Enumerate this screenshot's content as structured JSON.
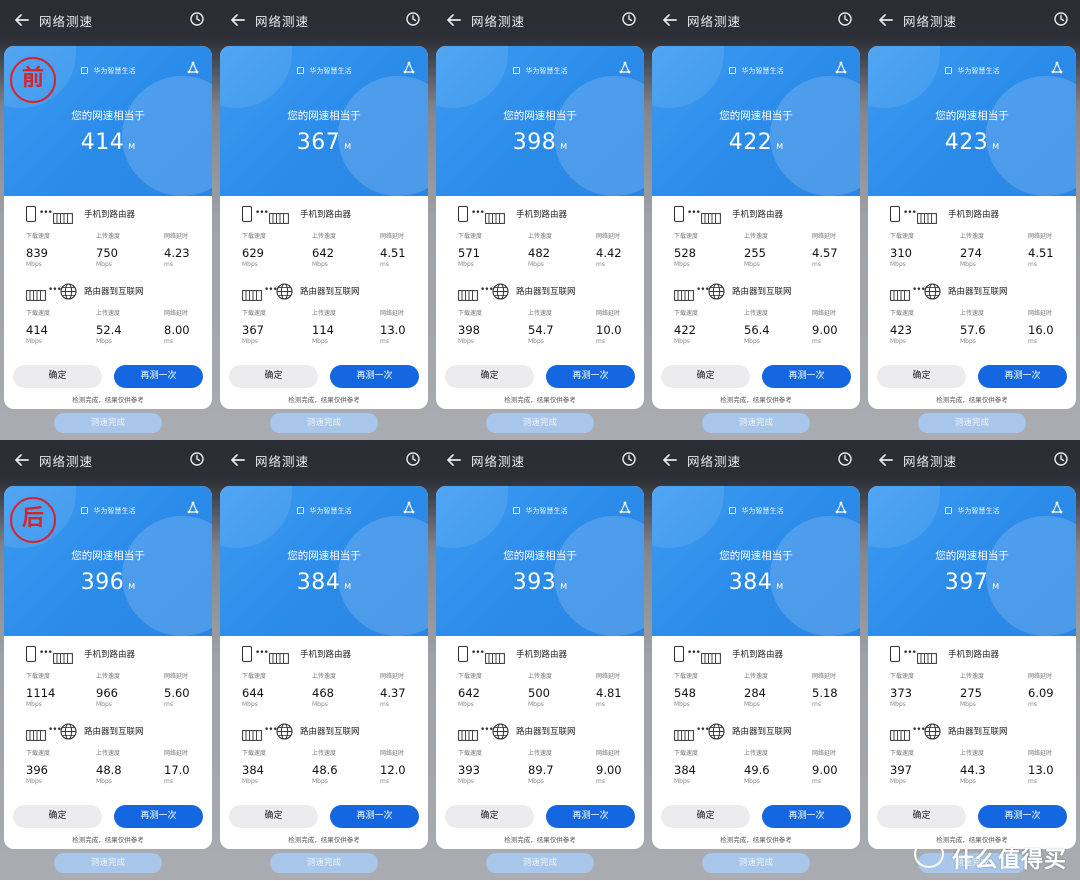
{
  "labels": {
    "nav_title": "网络测速",
    "brand": "华为智慧生活",
    "equivalent": "您的网速相当于",
    "speed_unit": "M",
    "sec_phone_router": "手机到路由器",
    "sec_router_internet": "路由器到互联网",
    "download": "下载速度",
    "upload": "上传速度",
    "latency": "网络延时",
    "unit_mbps": "Mbps",
    "unit_ms": "ms",
    "confirm": "确定",
    "retest": "再测一次",
    "footnote": "检测完成，结果仅供参考",
    "test_done": "测速完成"
  },
  "stamps": {
    "before": "前",
    "after": "后"
  },
  "watermark": {
    "text": "什么值得买"
  },
  "rows": [
    {
      "stamp": "前",
      "tests": [
        {
          "speed": "414",
          "phone_router": {
            "download": "839",
            "upload": "750",
            "latency": "4.23"
          },
          "router_internet": {
            "download": "414",
            "upload": "52.4",
            "latency": "8.00"
          }
        },
        {
          "speed": "367",
          "phone_router": {
            "download": "629",
            "upload": "642",
            "latency": "4.51"
          },
          "router_internet": {
            "download": "367",
            "upload": "114",
            "latency": "13.0"
          }
        },
        {
          "speed": "398",
          "phone_router": {
            "download": "571",
            "upload": "482",
            "latency": "4.42"
          },
          "router_internet": {
            "download": "398",
            "upload": "54.7",
            "latency": "10.0"
          }
        },
        {
          "speed": "422",
          "phone_router": {
            "download": "528",
            "upload": "255",
            "latency": "4.57"
          },
          "router_internet": {
            "download": "422",
            "upload": "56.4",
            "latency": "9.00"
          }
        },
        {
          "speed": "423",
          "phone_router": {
            "download": "310",
            "upload": "274",
            "latency": "4.51"
          },
          "router_internet": {
            "download": "423",
            "upload": "57.6",
            "latency": "16.0"
          }
        }
      ]
    },
    {
      "stamp": "后",
      "tests": [
        {
          "speed": "396",
          "phone_router": {
            "download": "1114",
            "upload": "966",
            "latency": "5.60"
          },
          "router_internet": {
            "download": "396",
            "upload": "48.8",
            "latency": "17.0"
          }
        },
        {
          "speed": "384",
          "phone_router": {
            "download": "644",
            "upload": "468",
            "latency": "4.37"
          },
          "router_internet": {
            "download": "384",
            "upload": "48.6",
            "latency": "12.0"
          }
        },
        {
          "speed": "393",
          "phone_router": {
            "download": "642",
            "upload": "500",
            "latency": "4.81"
          },
          "router_internet": {
            "download": "393",
            "upload": "89.7",
            "latency": "9.00"
          }
        },
        {
          "speed": "384",
          "phone_router": {
            "download": "548",
            "upload": "284",
            "latency": "5.18"
          },
          "router_internet": {
            "download": "384",
            "upload": "49.6",
            "latency": "9.00"
          }
        },
        {
          "speed": "397",
          "phone_router": {
            "download": "373",
            "upload": "275",
            "latency": "6.09"
          },
          "router_internet": {
            "download": "397",
            "upload": "44.3",
            "latency": "13.0"
          }
        }
      ]
    }
  ],
  "icons": {
    "back": "arrow-left-icon",
    "history": "clock-icon",
    "share": "share-icon",
    "phone": "phone-icon",
    "router": "router-icon",
    "globe": "globe-icon"
  },
  "colors": {
    "hero_blue": "#2b8be9",
    "retest_blue": "#1467e0",
    "stamp_red": "#d6242a",
    "done_button": "#a9c7ea"
  }
}
